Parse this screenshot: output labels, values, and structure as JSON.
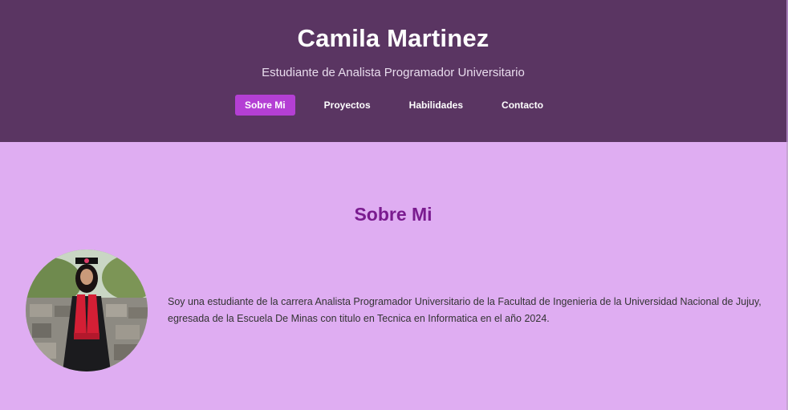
{
  "header": {
    "title": "Camila Martinez",
    "subtitle": "Estudiante de Analista Programador Universitario"
  },
  "nav": {
    "items": [
      {
        "label": "Sobre Mi",
        "active": true
      },
      {
        "label": "Proyectos",
        "active": false
      },
      {
        "label": "Habilidades",
        "active": false
      },
      {
        "label": "Contacto",
        "active": false
      }
    ]
  },
  "about": {
    "title": "Sobre Mi",
    "text": "Soy una estudiante de la carrera Analista Programador Universitario de la Facultad de Ingenieria de la Universidad Nacional de Jujuy, egresada de la Escuela De Minas con titulo en Tecnica en Informatica en el año 2024."
  },
  "colors": {
    "header_bg": "#5a3562",
    "page_bg": "#dfadf2",
    "accent": "#b43fd4",
    "section_title": "#7a1b8f"
  }
}
